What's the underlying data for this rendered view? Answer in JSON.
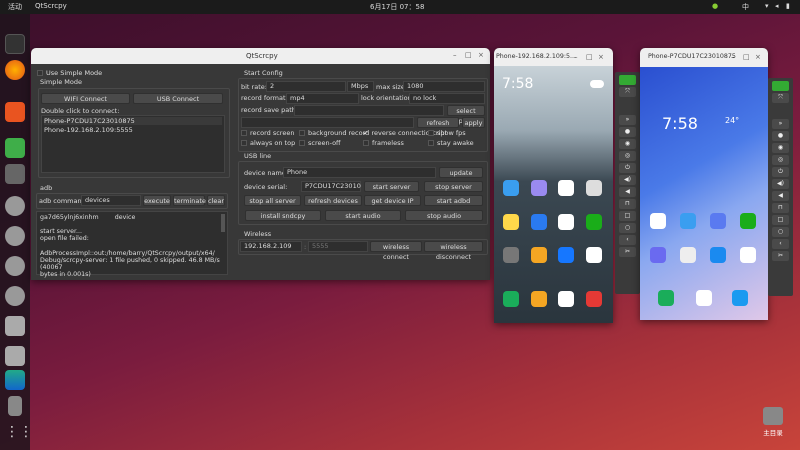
{
  "topbar": {
    "activities": "活动",
    "app": "QtScrcpy",
    "datetime": "6月17日 07：58",
    "ime": "中"
  },
  "main": {
    "title": "QtScrcpy",
    "use_simple_mode": "Use Simple Mode",
    "simple_mode": "Simple Mode",
    "wifi_connect": "WIFI Connect",
    "usb_connect": "USB Connect",
    "double_click": "Double click to connect:",
    "devices": [
      "Phone-P7CDU17C23010875",
      "Phone-192.168.2.109:5555"
    ],
    "adb": "adb",
    "adb_command_label": "adb command:",
    "adb_command": "devices",
    "execute": "execute",
    "terminate": "terminate",
    "clear": "clear",
    "log": [
      "ga7d65ylnj6xinhm        device",
      "",
      "start server...",
      "open file failed:",
      "",
      "AdbProcessImpl::out:/home/barry/QtScrcpy/output/x64/",
      "Debug/scrcpy-server: 1 file pushed, 0 skipped. 46.8 MB/s (40067",
      "bytes in 0.001s)"
    ],
    "start_config": "Start Config",
    "bit_rate_label": "bit rate:",
    "bit_rate": "2",
    "bit_unit": "Mbps",
    "max_size_label": "max size:",
    "max_size": "1080",
    "record_format_label": "record format:",
    "record_format": "mp4",
    "lock_orientation_label": "lock orientation:",
    "lock_orientation": "no lock",
    "record_save_path_label": "record save path:",
    "record_save_path": "",
    "select_path": "select path",
    "refresh_script": "refresh script",
    "apply": "apply",
    "options": [
      {
        "label": "record screen",
        "checked": false
      },
      {
        "label": "background record",
        "checked": false
      },
      {
        "label": "reverse connection",
        "checked": true
      },
      {
        "label": "show fps",
        "checked": false
      },
      {
        "label": "always on top",
        "checked": false
      },
      {
        "label": "screen-off",
        "checked": false
      },
      {
        "label": "frameless",
        "checked": false
      },
      {
        "label": "stay awake",
        "checked": false
      }
    ],
    "usb_line": "USB line",
    "device_name_label": "device name:",
    "device_name": "Phone",
    "update_name": "update name",
    "device_serial_label": "device serial:",
    "device_serial": "P7CDU17C23010",
    "start_server": "start server",
    "stop_server": "stop server",
    "stop_all_server": "stop all server",
    "refresh_devices": "refresh devices",
    "get_device_ip": "get device IP",
    "start_adbd": "start adbd",
    "install_sndcpy": "install sndcpy",
    "start_audio": "start audio",
    "stop_audio": "stop audio",
    "wireless": "Wireless",
    "ip": "192.168.2.109",
    "port_placeholder": "5555",
    "wireless_connect": "wireless connect",
    "wireless_disconnect": "wireless disconnect"
  },
  "phone1": {
    "title": "Phone-192.168.2.109:5...",
    "time": "7:58"
  },
  "phone2": {
    "title": "Phone-P7CDU17C23010875",
    "time": "7:58",
    "temp": "24°"
  },
  "home": {
    "label": "主目录"
  }
}
